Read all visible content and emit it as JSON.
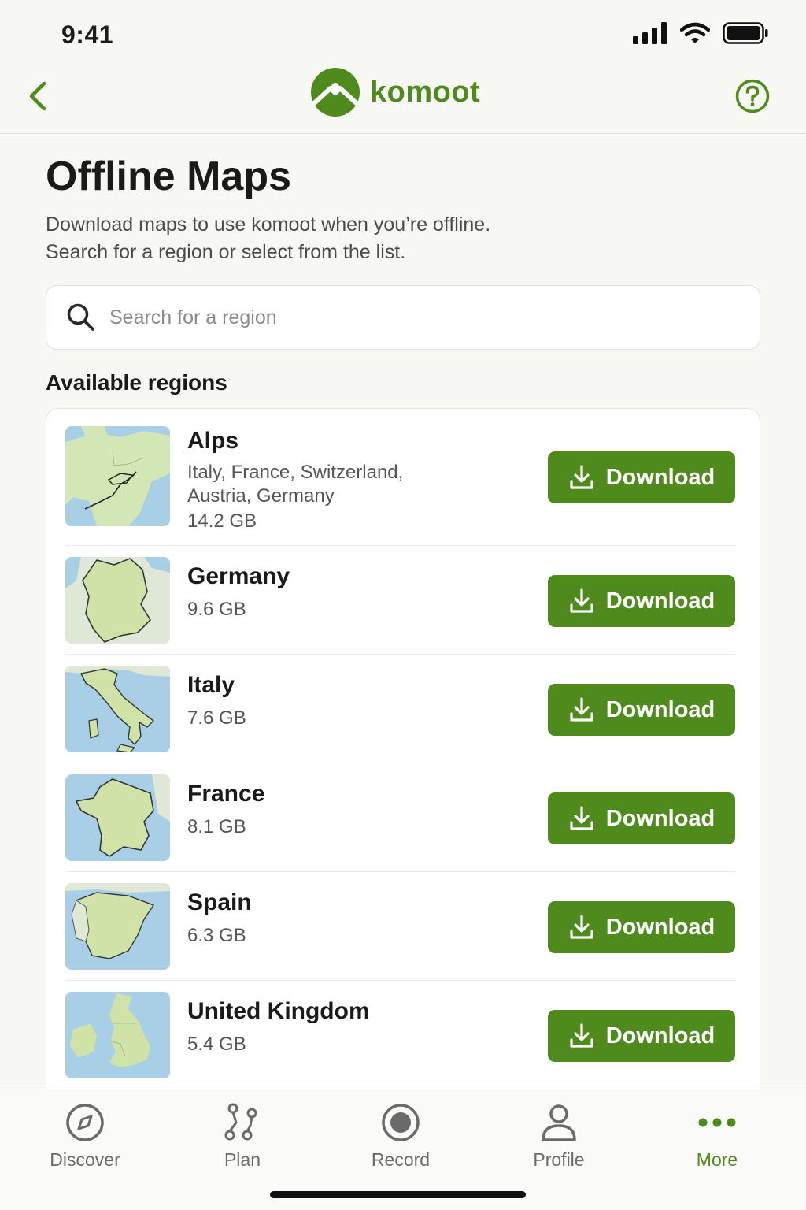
{
  "status_bar": {
    "time": "9:41"
  },
  "header": {
    "logo_text": "komoot",
    "brand_color": "#4f8a1c"
  },
  "page": {
    "title": "Offline Maps",
    "description_line1": "Download maps to use komoot when you’re offline.",
    "description_line2": "Search for a region or select from the list."
  },
  "search": {
    "placeholder": "Search for a region",
    "value": ""
  },
  "section_title": "Available regions",
  "regions": [
    {
      "name": "Alps",
      "countries_line1": "Italy, France, Switzerland,",
      "countries_line2": "Austria, Germany",
      "size": "14.2 GB",
      "button": "Download",
      "thumb": "alps-map-thumbnail"
    },
    {
      "name": "Germany",
      "size": "9.6 GB",
      "button": "Download",
      "thumb": "germany-map-thumbnail"
    },
    {
      "name": "Italy",
      "size": "7.6 GB",
      "button": "Download",
      "thumb": "italy-map-thumbnail"
    },
    {
      "name": "France",
      "size": "8.1 GB",
      "button": "Download",
      "thumb": "france-map-thumbnail"
    },
    {
      "name": "Spain",
      "size": "6.3 GB",
      "button": "Download",
      "thumb": "spain-map-thumbnail"
    },
    {
      "name": "United Kingdom",
      "size": "5.4 GB",
      "button": "Download",
      "thumb": "uk-map-thumbnail"
    }
  ],
  "tabs": [
    {
      "label": "Discover",
      "icon": "compass-icon",
      "active": false
    },
    {
      "label": "Plan",
      "icon": "route-icon",
      "active": false
    },
    {
      "label": "Record",
      "icon": "record-icon",
      "active": false
    },
    {
      "label": "Profile",
      "icon": "person-icon",
      "active": false
    },
    {
      "label": "More",
      "icon": "more-dots-icon",
      "active": true
    }
  ]
}
